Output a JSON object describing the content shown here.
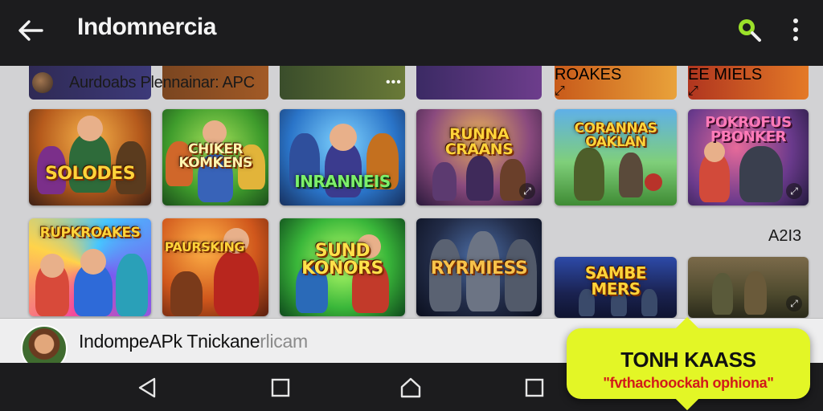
{
  "appbar": {
    "title": "Indomnercia",
    "back_icon": "back-arrow-icon",
    "search_icon": "search-icon",
    "search_accent": "#9be12a",
    "more_icon": "more-vert-icon"
  },
  "content": {
    "banner_label": "Aurdoabs Plennainar: APC",
    "banner_dots": "•••",
    "side_label": "A2I3",
    "tiles": [
      {
        "title": "SOLODES",
        "badge": ""
      },
      {
        "title": "CHIKER KOMKENS",
        "badge": ""
      },
      {
        "title": "INRANNEIS",
        "badge": ""
      },
      {
        "title": "RUNNA CRAANS",
        "badge": "⤢"
      },
      {
        "title": "CORANNAS OAKLAN",
        "badge": ""
      },
      {
        "title": "POKROFUS PBONKER",
        "badge": "⤢"
      },
      {
        "title": "RUPKROAKES",
        "badge": ""
      },
      {
        "title": "PAURSKING",
        "badge": ""
      },
      {
        "title": "SUND KONORS",
        "badge": ""
      },
      {
        "title": "RYRMIESS",
        "badge": ""
      },
      {
        "title": "SAMBE MERS",
        "badge": ""
      },
      {
        "title": "",
        "badge": "⤢"
      }
    ],
    "top_strip": [
      {
        "title": "",
        "badge": ""
      },
      {
        "title": "ROAKES",
        "badge": "⤢"
      },
      {
        "title": "EE MIELS",
        "badge": "⤢"
      }
    ]
  },
  "info_bar": {
    "text": "IndompeAPk Tnickane",
    "ghost_text": "rlicam"
  },
  "navbar": {
    "back_icon": "nav-back-triangle-icon",
    "recents_icon": "nav-square-icon",
    "home_icon": "nav-home-icon",
    "recents2_icon": "nav-square-icon"
  },
  "callout": {
    "title": "TONH KAASS",
    "subtitle": "\"fvthachoockah ophiona\"",
    "bg": "#e3f626",
    "subtitle_color": "#d21a1a"
  }
}
